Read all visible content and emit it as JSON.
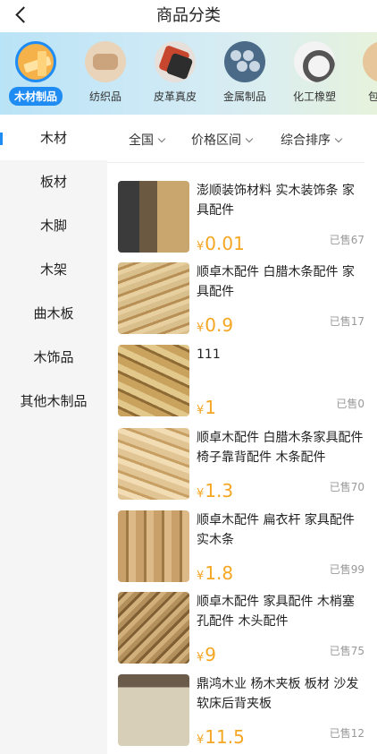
{
  "header": {
    "title": "商品分类"
  },
  "categories": [
    {
      "label": "木材制品",
      "icon": "wood-products-icon",
      "active": true
    },
    {
      "label": "纺织品",
      "icon": "textile-icon"
    },
    {
      "label": "皮革真皮",
      "icon": "leather-icon"
    },
    {
      "label": "金属制品",
      "icon": "metal-products-icon"
    },
    {
      "label": "化工橡塑",
      "icon": "chemical-rubber-icon"
    },
    {
      "label": "包",
      "icon": "more-category-icon"
    }
  ],
  "sidebar": {
    "items": [
      {
        "label": "木材",
        "active": true
      },
      {
        "label": "板材"
      },
      {
        "label": "木脚"
      },
      {
        "label": "木架"
      },
      {
        "label": "曲木板"
      },
      {
        "label": "木饰品"
      },
      {
        "label": "其他木制品"
      }
    ]
  },
  "filters": {
    "region": "全国",
    "price": "价格区间",
    "sort": "综合排序"
  },
  "products": [
    {
      "name": "澎顺装饰材料 实木装饰条 家具配件",
      "price": "0.01",
      "sold": "已售67"
    },
    {
      "name": "顺卓木配件 白腊木条配件 家具配件",
      "price": "0.9",
      "sold": "已售17"
    },
    {
      "name": "111",
      "price": "1",
      "sold": "已售0"
    },
    {
      "name": "顺卓木配件 白腊木条家具配件 椅子靠背配件 木条配件",
      "price": "1.3",
      "sold": "已售70"
    },
    {
      "name": "顺卓木配件 扁衣杆 家具配件 实木条",
      "price": "1.8",
      "sold": "已售99"
    },
    {
      "name": "顺卓木配件 家具配件 木梢塞孔配件 木头配件",
      "price": "9",
      "sold": "已售75"
    },
    {
      "name": "鼎鸿木业 杨木夹板 板材 沙发软床后背夹板",
      "price": "11.5",
      "sold": "已售12"
    }
  ],
  "currency": "¥",
  "colors": {
    "accent": "#1f8cf4",
    "price": "#f5a623"
  }
}
